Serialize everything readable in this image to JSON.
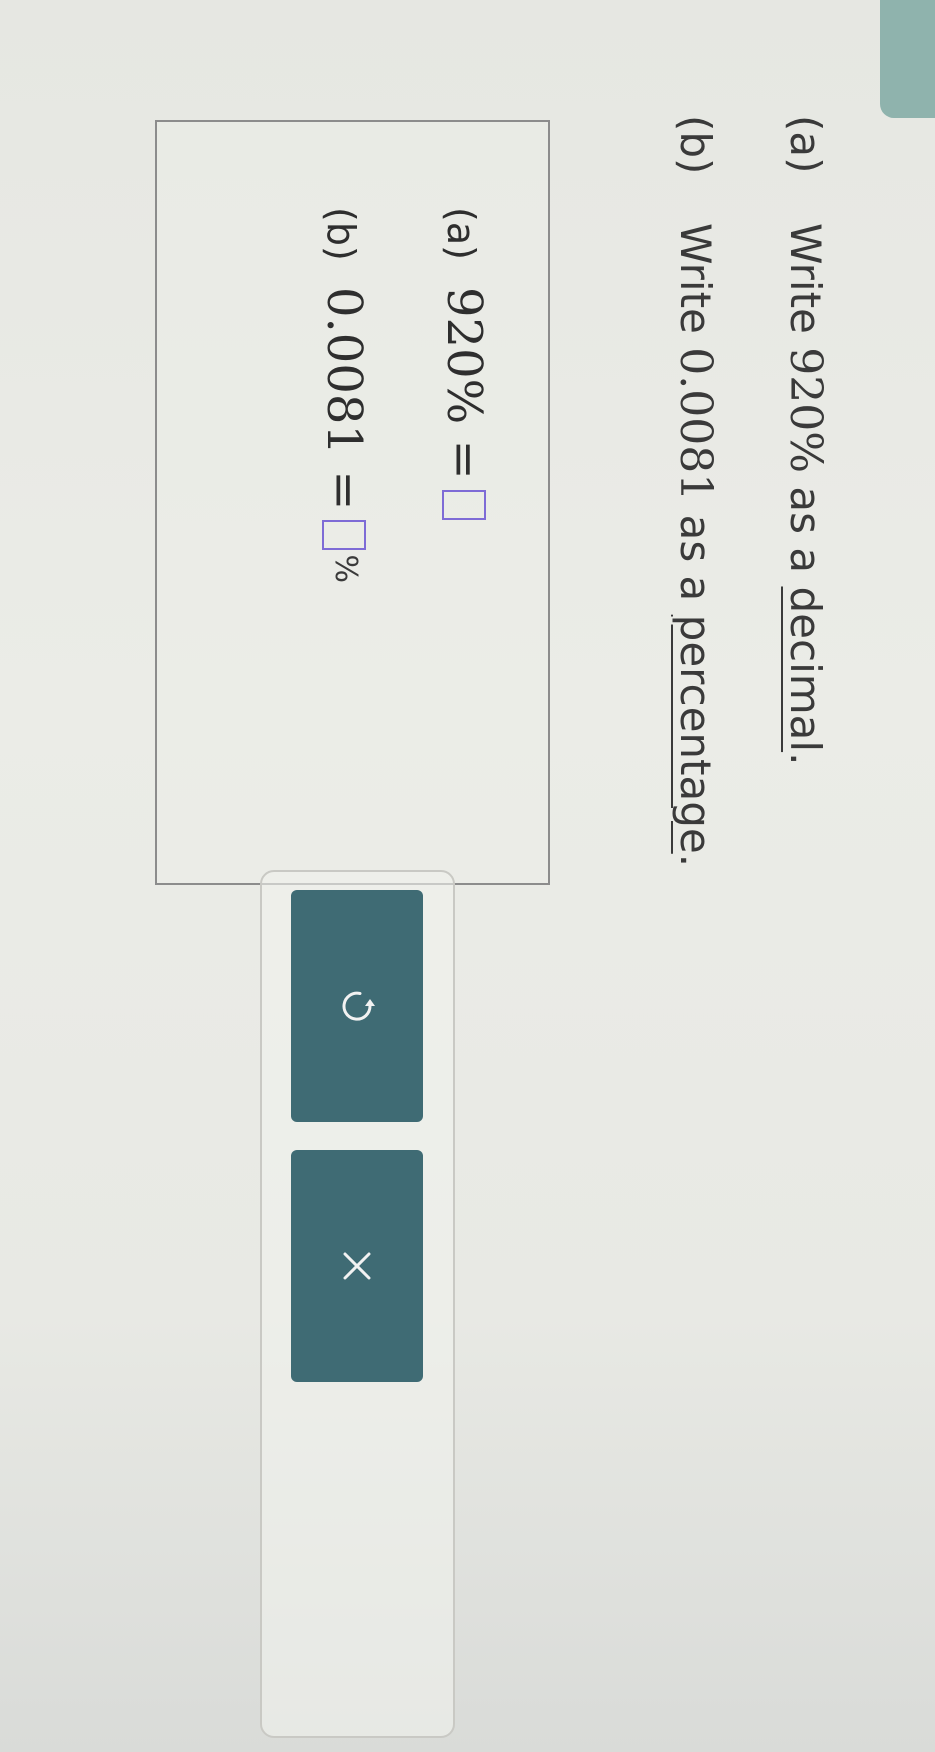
{
  "question": {
    "part_a": {
      "label": "(a)",
      "prefix": "Write",
      "value": "920%",
      "middle": "as a",
      "term": "decimal",
      "suffix": "."
    },
    "part_b": {
      "label": "(b)",
      "prefix": "Write",
      "value": "0.0081",
      "middle": "as a",
      "term": "percentage",
      "suffix": "."
    }
  },
  "answers": {
    "part_a": {
      "label": "(a)",
      "expression": "920% =",
      "input_value": ""
    },
    "part_b": {
      "label": "(b)",
      "expression": "0.0081 =",
      "input_value": "",
      "unit": "%"
    }
  },
  "tools": {
    "undo_icon": "undo-icon",
    "clear_icon": "close-icon"
  },
  "colors": {
    "button_bg": "#3f6b74",
    "input_border": "#7e6bd6",
    "background": "#e8e9e4"
  }
}
